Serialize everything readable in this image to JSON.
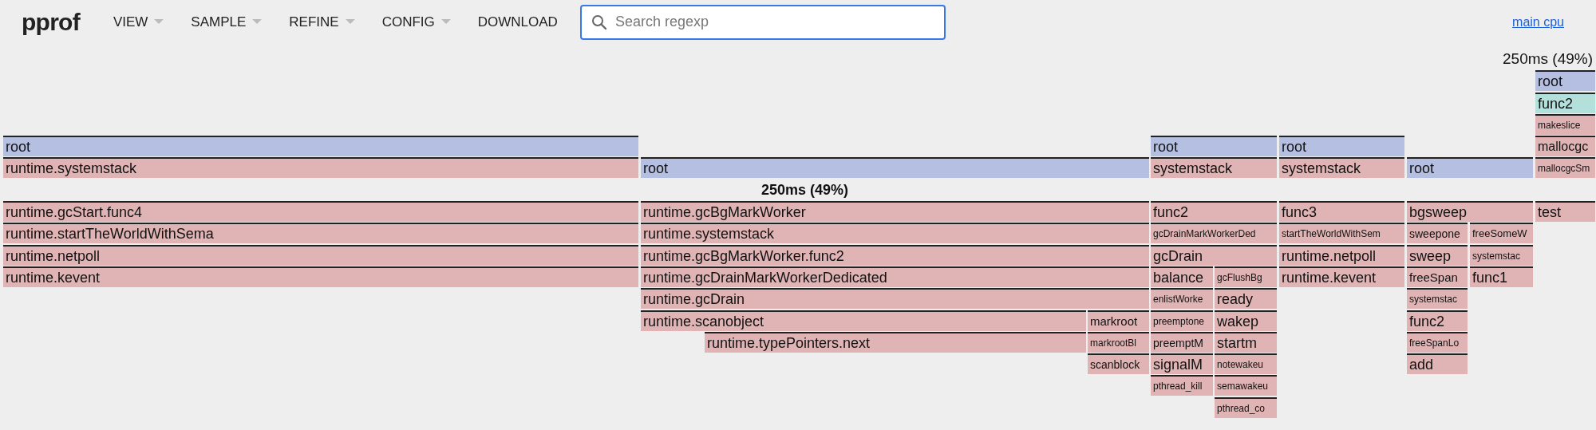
{
  "header": {
    "logo": "pprof",
    "menus": [
      {
        "label": "VIEW",
        "dropdown": true
      },
      {
        "label": "SAMPLE",
        "dropdown": true
      },
      {
        "label": "REFINE",
        "dropdown": true
      },
      {
        "label": "CONFIG",
        "dropdown": true
      },
      {
        "label": "DOWNLOAD",
        "dropdown": false
      }
    ],
    "search": {
      "placeholder": "Search regexp"
    },
    "link": "main cpu"
  },
  "flame_graph": {
    "stacks": [
      {
        "callers": [
          {
            "name": "root",
            "color": "#b4bfe2"
          },
          {
            "name": "runtime.systemstack",
            "color": "#e0b4b4"
          }
        ],
        "callees": [
          {
            "name": "runtime.gcStart.func4",
            "color": "#e0b4b4",
            "children": [
              {
                "name": "runtime.startTheWorldWithSema",
                "color": "#e0b4b4",
                "children": [
                  {
                    "name": "runtime.netpoll",
                    "color": "#e0b4b4",
                    "children": [
                      {
                        "name": "runtime.kevent",
                        "color": "#e0b4b4"
                      }
                    ]
                  }
                ]
              }
            ]
          }
        ]
      },
      {
        "callers": [
          {
            "name": "root",
            "color": "#b4bfe2"
          }
        ],
        "label": "250ms (49%)",
        "callees": [
          {
            "name": "runtime.gcBgMarkWorker",
            "color": "#e0b4b4",
            "children": [
              {
                "name": "runtime.systemstack",
                "color": "#e0b4b4",
                "children": [
                  {
                    "name": "runtime.gcBgMarkWorker.func2",
                    "color": "#e0b4b4",
                    "children": [
                      {
                        "name": "runtime.gcDrainMarkWorkerDedicated",
                        "color": "#e0b4b4",
                        "children": [
                          {
                            "name": "runtime.gcDrain",
                            "color": "#e0b4b4",
                            "children": [
                              {
                                "name": "runtime.scanobject",
                                "color": "#e0b4b4",
                                "children": [
                                  {
                                    "name": "runtime.typePointers.next",
                                    "color": "#e0b4b4"
                                  }
                                ]
                              },
                              {
                                "name": "markroot",
                                "color": "#e0b4b4",
                                "children": [
                                  {
                                    "name": "markrootBl",
                                    "color": "#e0b4b4",
                                    "children": [
                                      {
                                        "name": "scanblock",
                                        "color": "#e0b4b4"
                                      }
                                    ]
                                  }
                                ]
                              }
                            ]
                          }
                        ]
                      }
                    ]
                  }
                ]
              }
            ]
          }
        ]
      },
      {
        "callers": [
          {
            "name": "root",
            "color": "#b4bfe2"
          },
          {
            "name": "systemstack",
            "color": "#e0b4b4"
          }
        ],
        "callees": [
          {
            "name": "func2",
            "color": "#e0b4b4",
            "children": [
              {
                "name": "gcDrainMarkWorkerDed",
                "color": "#e0b4b4",
                "children": [
                  {
                    "name": "gcDrain",
                    "color": "#e0b4b4",
                    "children": [
                      {
                        "name": "balance",
                        "color": "#e0b4b4",
                        "children": [
                          {
                            "name": "enlistWorke",
                            "color": "#e0b4b4",
                            "children": [
                              {
                                "name": "preemptone",
                                "color": "#e0b4b4",
                                "children": [
                                  {
                                    "name": "preemptM",
                                    "color": "#e0b4b4",
                                    "children": [
                                      {
                                        "name": "signalM",
                                        "color": "#e0b4b4",
                                        "children": [
                                          {
                                            "name": "pthread_kill",
                                            "color": "#e0b4b4"
                                          }
                                        ]
                                      }
                                    ]
                                  }
                                ]
                              }
                            ]
                          }
                        ]
                      },
                      {
                        "name": "gcFlushBg",
                        "color": "#e0b4b4",
                        "children": [
                          {
                            "name": "ready",
                            "color": "#e0b4b4",
                            "children": [
                              {
                                "name": "wakep",
                                "color": "#e0b4b4",
                                "children": [
                                  {
                                    "name": "startm",
                                    "color": "#e0b4b4",
                                    "children": [
                                      {
                                        "name": "notewakeu",
                                        "color": "#e0b4b4",
                                        "children": [
                                          {
                                            "name": "semawakeu",
                                            "color": "#e0b4b4",
                                            "children": [
                                              {
                                                "name": "pthread_co",
                                                "color": "#e0b4b4"
                                              }
                                            ]
                                          }
                                        ]
                                      }
                                    ]
                                  }
                                ]
                              }
                            ]
                          }
                        ]
                      }
                    ]
                  }
                ]
              }
            ]
          }
        ]
      },
      {
        "callers": [
          {
            "name": "root",
            "color": "#b4bfe2"
          },
          {
            "name": "systemstack",
            "color": "#e0b4b4"
          }
        ],
        "callees": [
          {
            "name": "func3",
            "color": "#e0b4b4",
            "children": [
              {
                "name": "startTheWorldWithSem",
                "color": "#e0b4b4",
                "children": [
                  {
                    "name": "runtime.netpoll",
                    "color": "#e0b4b4",
                    "children": [
                      {
                        "name": "runtime.kevent",
                        "color": "#e0b4b4"
                      }
                    ]
                  }
                ]
              }
            ]
          }
        ]
      },
      {
        "callers": [
          {
            "name": "root",
            "color": "#b4bfe2"
          }
        ],
        "callees": [
          {
            "name": "bgsweep",
            "color": "#e0b4b4",
            "children": [
              {
                "name": "sweepone",
                "color": "#e0b4b4",
                "children": [
                  {
                    "name": "sweep",
                    "color": "#e0b4b4",
                    "children": [
                      {
                        "name": "freeSpan",
                        "color": "#e0b4b4",
                        "children": [
                          {
                            "name": "systemstac",
                            "color": "#e0b4b4",
                            "children": [
                              {
                                "name": "func2",
                                "color": "#e0b4b4",
                                "children": [
                                  {
                                    "name": "freeSpanLo",
                                    "color": "#e0b4b4",
                                    "children": [
                                      {
                                        "name": "add",
                                        "color": "#e0b4b4"
                                      }
                                    ]
                                  }
                                ]
                              }
                            ]
                          }
                        ]
                      }
                    ]
                  }
                ]
              },
              {
                "name": "freeSomeW",
                "color": "#e0b4b4",
                "children": [
                  {
                    "name": "systemstac",
                    "color": "#e0b4b4",
                    "children": [
                      {
                        "name": "func1",
                        "color": "#e0b4b4"
                      }
                    ]
                  }
                ]
              }
            ]
          }
        ]
      },
      {
        "label": "250ms (49%)",
        "callers": [
          {
            "name": "root",
            "color": "#b4bfe2"
          },
          {
            "name": "func2",
            "color": "#b4e0dc"
          },
          {
            "name": "makeslice",
            "color": "#e0b4b4"
          },
          {
            "name": "mallocgc",
            "color": "#e0b4b4"
          },
          {
            "name": "mallocgcSm",
            "color": "#e0b4b4"
          }
        ],
        "callees": [
          {
            "name": "test",
            "color": "#e0b4b4"
          }
        ]
      }
    ]
  }
}
